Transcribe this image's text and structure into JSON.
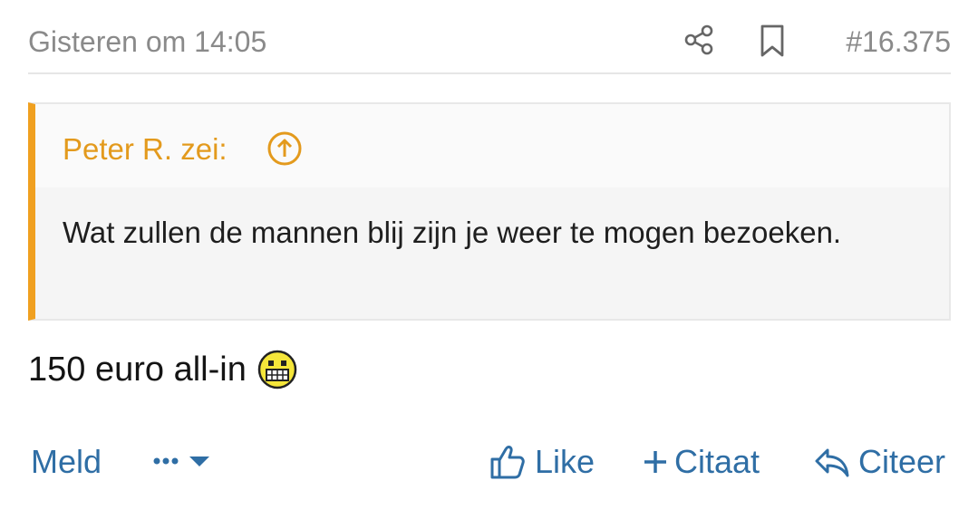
{
  "post": {
    "timestamp": "Gisteren om 14:05",
    "number": "#16.375",
    "quote": {
      "author": "Peter R. zei:",
      "text": "Wat zullen de mannen blij zijn je weer te mogen bezoeken."
    },
    "message": "150 euro all-in",
    "emoji": "grinning-smiley"
  },
  "actions": {
    "report": "Meld",
    "like": "Like",
    "multiquote": "Citaat",
    "reply": "Citeer"
  },
  "colors": {
    "accent": "#2f6ea5",
    "quote_accent": "#f0a020",
    "muted": "#8a8a8a"
  }
}
